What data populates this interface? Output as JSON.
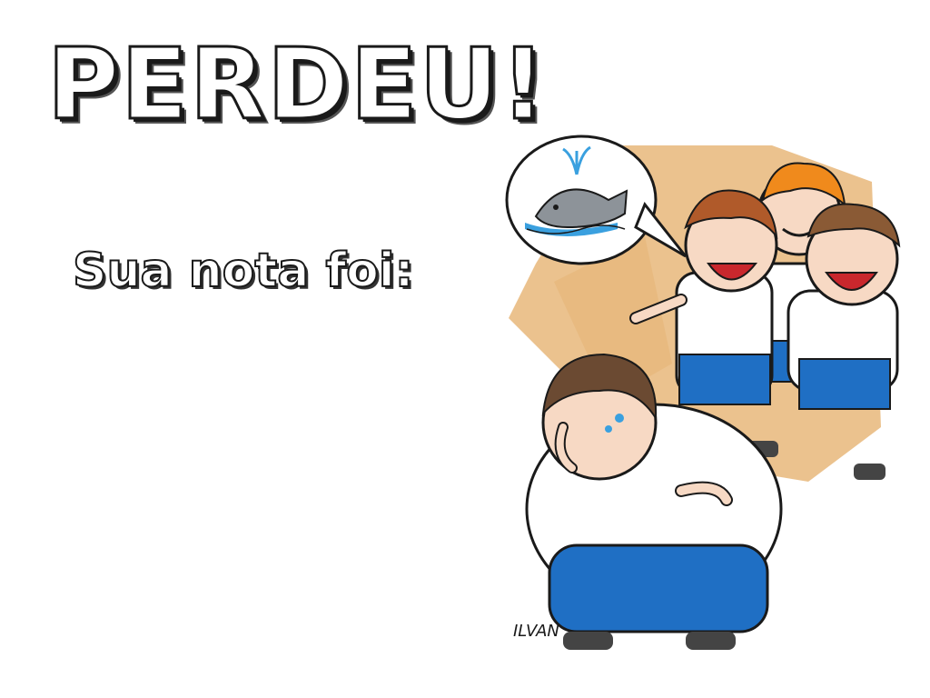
{
  "slide": {
    "title": "PERDEU!",
    "subtitle": "Sua nota foi:",
    "signature": "ILVAN"
  },
  "illustration": {
    "icons": [
      "cartoon-children-laughing-illustration",
      "whale-icon",
      "speech-bubble-icon",
      "crying-boy-illustration"
    ]
  },
  "colors": {
    "background": "#ffffff",
    "shirt": "#ffffff",
    "shorts": "#1f6fc4",
    "skin": "#f7d9c4",
    "hair_brown": "#6b4a32",
    "hair_orange": "#f08a1c",
    "splash": "#e7b77a",
    "whale": "#8d9399",
    "water": "#3aa0df"
  }
}
